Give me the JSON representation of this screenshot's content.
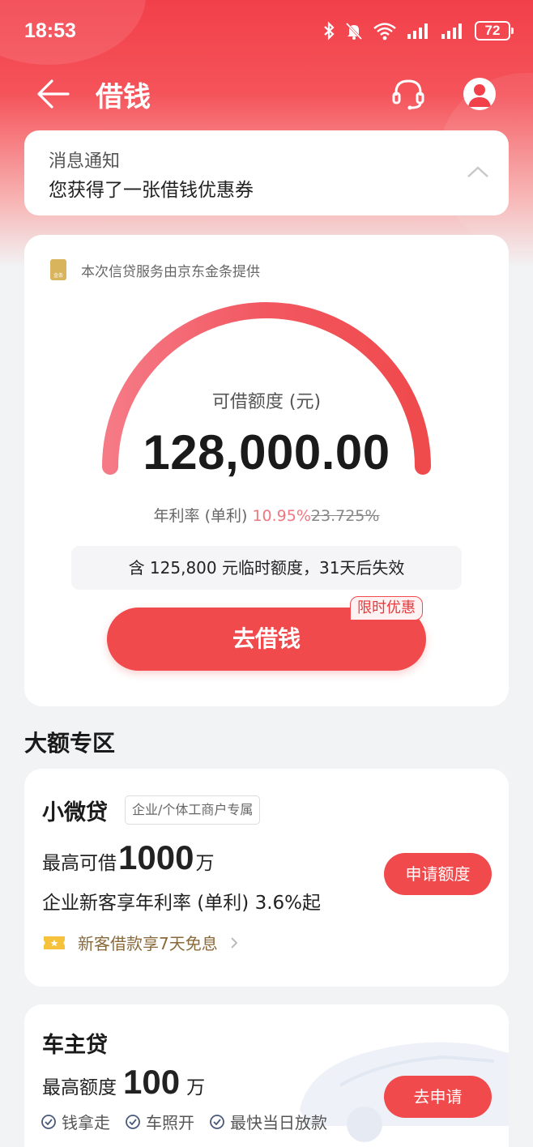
{
  "status_bar": {
    "time": "18:53",
    "battery": "72"
  },
  "nav": {
    "title": "借钱"
  },
  "notice": {
    "title": "消息通知",
    "text": "您获得了一张借钱优惠券"
  },
  "credit": {
    "provider": "本次信贷服务由京东金条提供",
    "label": "可借额度 (元)",
    "amount": "128,000.00",
    "rate_label": "年利率 (单利) ",
    "rate_new": "10.95%",
    "rate_old": "23.725%",
    "temp_note": "含 125,800 元临时额度，31天后失效",
    "borrow_button": "去借钱",
    "promo_tag": "限时优惠"
  },
  "section": {
    "title": "大额专区"
  },
  "products": [
    {
      "name": "小微贷",
      "tag": "企业/个体工商户专属",
      "max_label": "最高可借",
      "max_value": "1000",
      "max_unit": "万",
      "desc": "企业新客享年利率 (单利) 3.6%起",
      "coupon": "新客借款享7天免息",
      "button": "申请额度"
    },
    {
      "name": "车主贷",
      "max_label": "最高额度",
      "max_value": "100",
      "max_unit": "万",
      "features": [
        "钱拿走",
        "车照开",
        "最快当日放款"
      ],
      "button": "去申请"
    }
  ],
  "colors": {
    "brand_red": "#f04a4c",
    "rate_red": "#f07680"
  }
}
